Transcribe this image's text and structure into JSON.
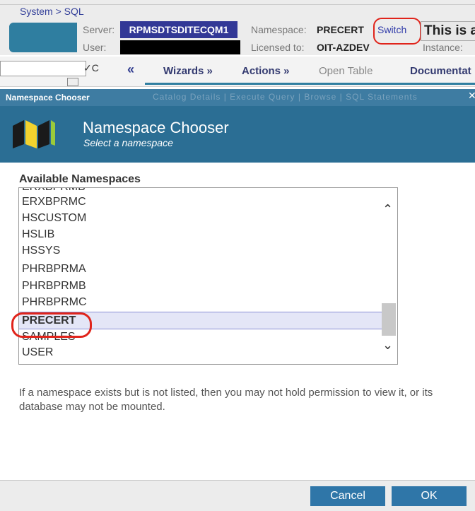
{
  "header": {
    "breadcrumb": "System > SQL",
    "server_label": "Server:",
    "server_value": "RPMSDTSDITECQM1",
    "user_label": "User:",
    "namespace_label": "Namespace:",
    "namespace_value": "PRECERT",
    "switch_label": "Switch",
    "licensed_label": "Licensed to:",
    "licensed_value": "OIT-AZDEV",
    "instance_label": "Instance:",
    "environment_text": "This is a"
  },
  "menu": {
    "combo_arrow": "✓C",
    "collapse_icon": "«",
    "items": [
      "Wizards »",
      "Actions »",
      "Open Table",
      "Documentat"
    ]
  },
  "dialog": {
    "titlebar": "Namespace Chooser",
    "ghost_tabs": "Catalog Details | Execute Query | Browse | SQL Statements",
    "title": "Namespace Chooser",
    "subtitle": "Select a namespace",
    "section_label": "Available Namespaces",
    "namespaces": [
      "ERXBPRMB",
      "ERXBPRMC",
      "HSCUSTOM",
      "HSLIB",
      "HSSYS",
      "PHRBPRMA",
      "PHRBPRMB",
      "PHRBPRMC",
      "PRECERT",
      "SAMPLES",
      "USER"
    ],
    "selected": "PRECERT",
    "help_text": "If a namespace exists but is not listed, then you may not hold permission to view it, or its database may not be mounted.",
    "cancel_label": "Cancel",
    "ok_label": "OK"
  },
  "colors": {
    "banner": "#2b6e94",
    "server_badge": "#323896",
    "highlight_ring": "#e0241b",
    "button": "#2f76a8"
  }
}
